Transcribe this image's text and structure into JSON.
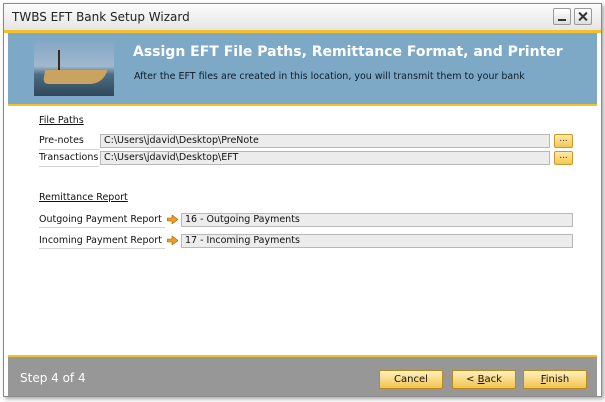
{
  "window": {
    "title": "TWBS EFT Bank Setup Wizard"
  },
  "header": {
    "title": "Assign EFT File Paths, Remittance Format, and Printer",
    "subtitle": "After the EFT files are created in this location, you will transmit them to your bank"
  },
  "file_paths": {
    "section_label": "File Paths",
    "prenotes": {
      "label": "Pre-notes",
      "value": "C:\\Users\\jdavid\\Desktop\\PreNote",
      "browse": "..."
    },
    "transactions": {
      "label": "Transactions",
      "value": "C:\\Users\\jdavid\\Desktop\\EFT",
      "browse": "..."
    }
  },
  "remittance": {
    "section_label": "Remittance Report",
    "outgoing": {
      "label": "Outgoing Payment Report",
      "value": "16 - Outgoing Payments"
    },
    "incoming": {
      "label": "Incoming Payment Report",
      "value": "17 - Incoming Payments"
    }
  },
  "footer": {
    "step": "Step 4 of 4",
    "cancel": "Cancel",
    "back_prefix": "< ",
    "back_accel": "B",
    "back_rest": "ack",
    "finish_accel": "F",
    "finish_rest": "inish"
  },
  "colors": {
    "accent": "#f3c22a",
    "header_bg": "#7ea9c6",
    "footer_bg": "#979797",
    "link_arrow": "#f0a020"
  },
  "icons": [
    "minimize-icon",
    "close-icon",
    "link-arrow-icon"
  ]
}
